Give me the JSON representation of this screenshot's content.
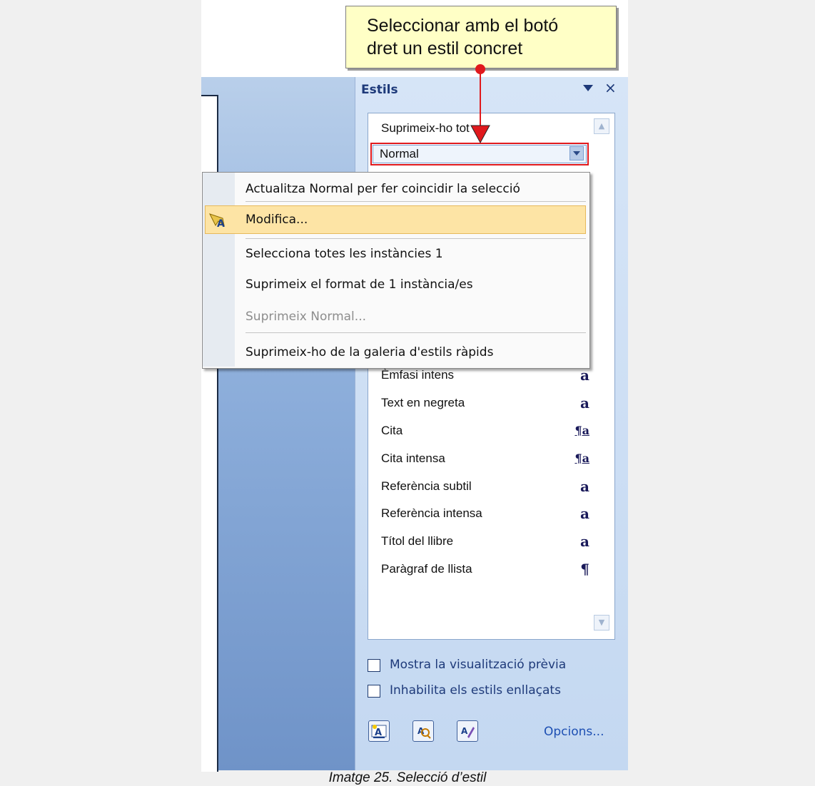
{
  "callout": {
    "text_line1": "Seleccionar amb el botó",
    "text_line2": "dret un estil concret"
  },
  "pane": {
    "title": "Estils",
    "dropdown_icon": "triangle-down-icon",
    "close_label": "×",
    "top_item": "Suprimeix-ho tot",
    "selected_style": "Normal",
    "styles": [
      {
        "name": "Èmfasi intens",
        "glyph": "a"
      },
      {
        "name": "Text en negreta",
        "glyph": "a"
      },
      {
        "name": "Cita",
        "glyph": "¶a"
      },
      {
        "name": "Cita intensa",
        "glyph": "¶a"
      },
      {
        "name": "Referència subtil",
        "glyph": "a"
      },
      {
        "name": "Referència intensa",
        "glyph": "a"
      },
      {
        "name": "Títol del llibre",
        "glyph": "a"
      },
      {
        "name": "Paràgraf de llista",
        "glyph": "¶"
      }
    ],
    "checkbox1": "Mostra la visualització prèvia",
    "checkbox2": "Inhabilita els estils enllaçats",
    "options_link": "Opcions..."
  },
  "menu": {
    "update": "Actualitza Normal per fer coincidir la selecció",
    "modify": "Modifica...",
    "select_all": "Selecciona totes les instàncies 1",
    "clear_format": "Suprimeix el format de 1 instància/es",
    "delete": "Suprimeix Normal...",
    "remove_gallery": "Suprimeix-ho de la galeria d'estils ràpids"
  },
  "caption": "Imatge 25. Selecció d’estil",
  "colors": {
    "highlight": "#fde4a5",
    "callout_bg": "#ffffc6",
    "arrow": "#e0191d",
    "pane_title": "#1e3a7a"
  }
}
